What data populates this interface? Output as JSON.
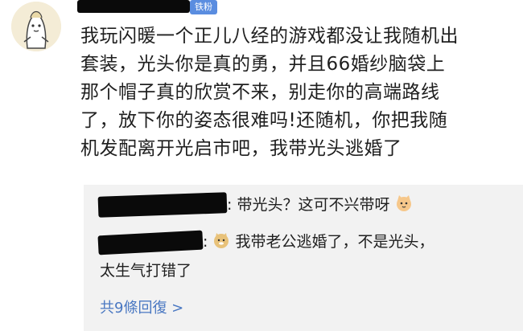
{
  "post": {
    "badge": "铁粉",
    "comment_lines": [
      "我玩闪暖一个正儿八经的游戏都没让我随机出",
      "套装，光头你是真的勇，并且66婚纱脑袋上",
      "那个帽子真的欣赏不来，别走你的高端路线",
      "了，放下你的姿态很难吗!还随机，你把我随",
      "机发配离开光启市吧，我带光头逃婚了"
    ]
  },
  "replies": [
    {
      "text": "带光头？这可不兴带呀",
      "emoji_after": "cat-emoji"
    },
    {
      "emoji_before": "doge-emoji",
      "line1": "我带老公逃婚了，不是光头，",
      "line2": "太生气打错了"
    }
  ],
  "more_replies_label": "共9條回復 >",
  "colors": {
    "link": "#4a78c2",
    "badge": "#5a8de0",
    "reply_bg": "#f2f2f2"
  }
}
